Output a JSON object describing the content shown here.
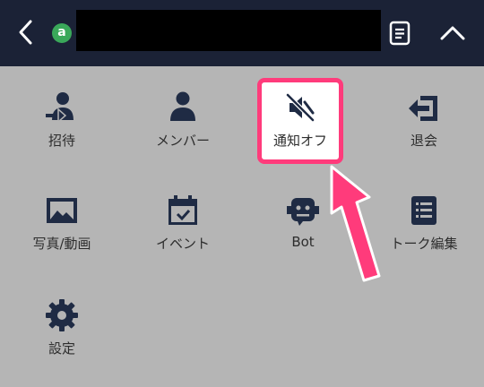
{
  "header": {
    "chat_title": "",
    "avatar_letter": "a"
  },
  "menu": {
    "items": [
      {
        "label": "招待",
        "icon": "invite-icon"
      },
      {
        "label": "メンバー",
        "icon": "members-icon"
      },
      {
        "label": "通知オフ",
        "icon": "mute-icon"
      },
      {
        "label": "退会",
        "icon": "leave-icon"
      },
      {
        "label": "写真/動画",
        "icon": "photo-icon"
      },
      {
        "label": "イベント",
        "icon": "calendar-icon"
      },
      {
        "label": "Bot",
        "icon": "bot-icon"
      },
      {
        "label": "トーク編集",
        "icon": "list-icon"
      },
      {
        "label": "設定",
        "icon": "gear-icon"
      }
    ]
  },
  "colors": {
    "header_bg": "#1b2236",
    "menu_bg": "#b5b5b5",
    "icon": "#1f2b44",
    "highlight": "#ff3b7b"
  }
}
